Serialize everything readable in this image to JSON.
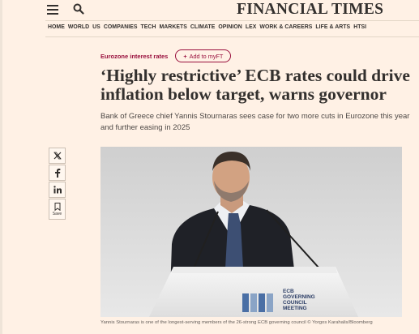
{
  "header": {
    "masthead": "FINANCIAL TIMES",
    "menu_icon": "hamburger-menu-icon",
    "search_icon": "search-icon"
  },
  "nav": {
    "items": [
      "HOME",
      "WORLD",
      "US",
      "COMPANIES",
      "TECH",
      "MARKETS",
      "CLIMATE",
      "OPINION",
      "LEX",
      "WORK & CAREERS",
      "LIFE & ARTS",
      "HTSI"
    ]
  },
  "article": {
    "topic": "Eurozone interest rates",
    "add_to_myft": "Add to myFT",
    "headline": "‘Highly restrictive’ ECB rates could drive inflation below target, warns governor",
    "standfirst": "Bank of Greece chief Yannis Stournaras sees case for two more cuts in Eurozone this year and further easing in 2025",
    "podium_text": [
      "ECB",
      "GOVERNING",
      "COUNCIL",
      "MEETING"
    ],
    "caption": "Yannis Stournaras is one of the longest-serving members of the 26-strong ECB governing council © Yorgos Karahalis/Bloomberg"
  },
  "share": {
    "x_icon": "x-twitter-icon",
    "facebook_icon": "facebook-icon",
    "linkedin_icon": "linkedin-icon",
    "save_icon": "bookmark-icon",
    "save_label": "Save"
  },
  "colors": {
    "background": "#fff1e5",
    "accent": "#990f3d",
    "text": "#33302e"
  }
}
